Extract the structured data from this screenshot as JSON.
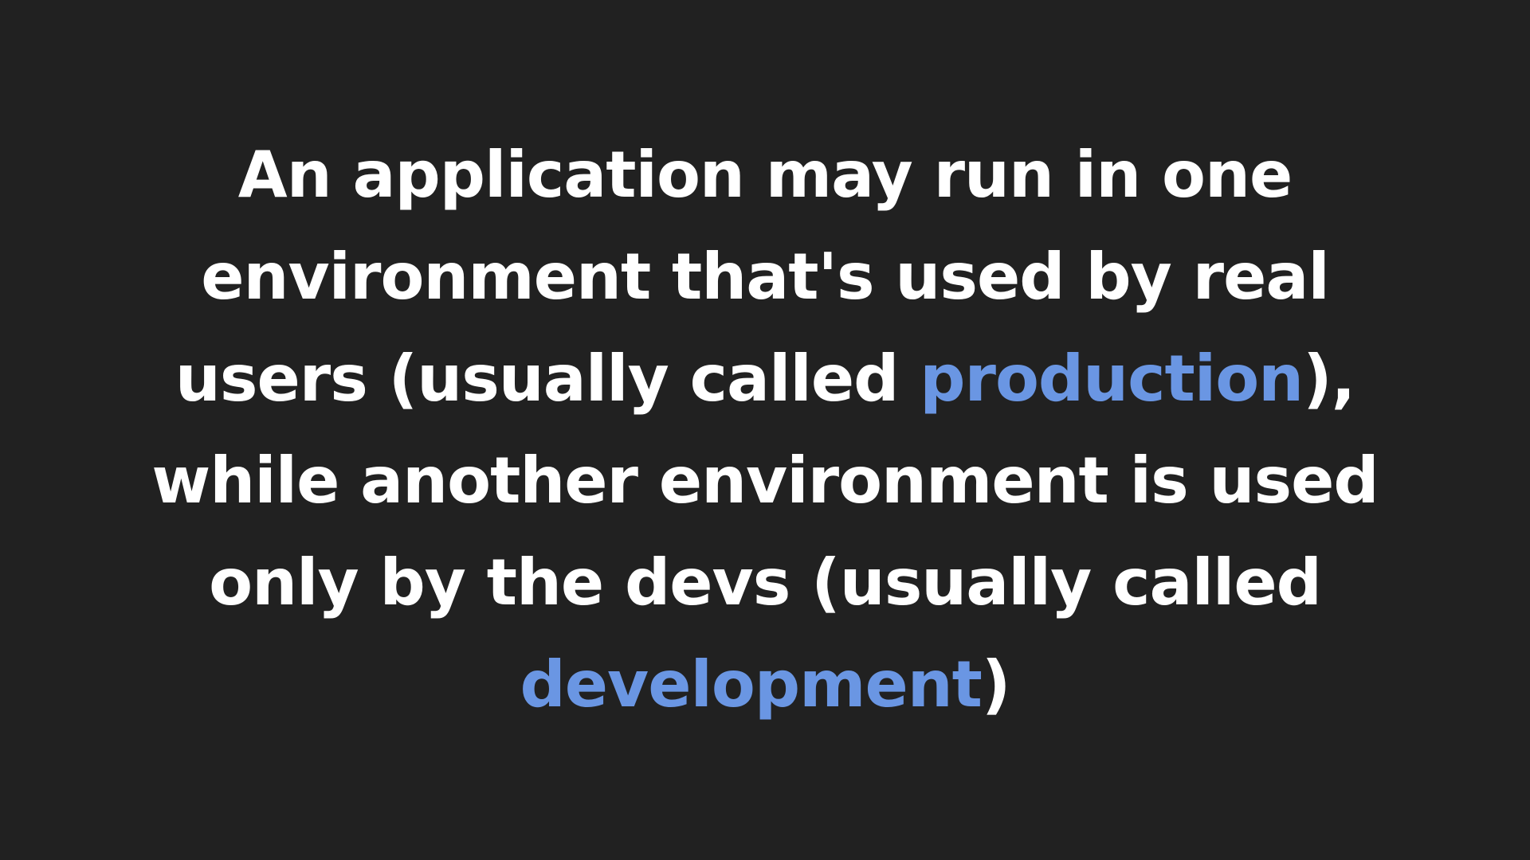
{
  "slide": {
    "lines": [
      {
        "text": "An application may run in one"
      },
      {
        "text": "environment that's used by real"
      },
      {
        "before": "users (usually called ",
        "highlight": "production",
        "after": "),"
      },
      {
        "text": "while another environment is used"
      },
      {
        "text": "only by the devs (usually called"
      },
      {
        "before": "",
        "highlight": "development",
        "after": ")"
      }
    ]
  },
  "colors": {
    "background": "#212121",
    "text": "#ffffff",
    "accent": "#6a96e3"
  }
}
